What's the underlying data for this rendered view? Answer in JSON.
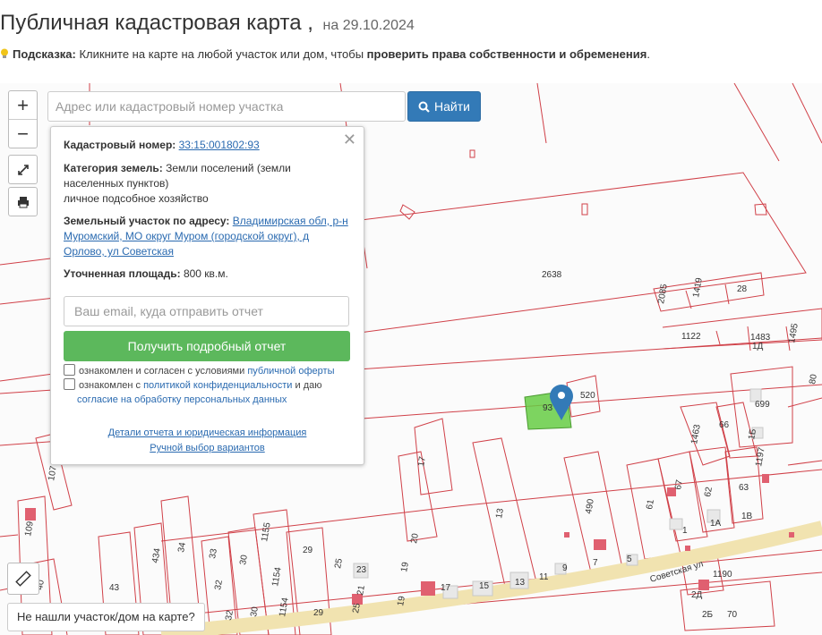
{
  "header": {
    "title": "Публичная кадастровая карта ,",
    "date": "на 29.10.2024",
    "hint_label": "Подсказка:",
    "hint_text": " Кликните на карте на любой участок или дом, чтобы ",
    "hint_bold": "проверить права собственности и обременения",
    "hint_end": "."
  },
  "search": {
    "placeholder": "Адрес или кадастровый номер участка",
    "button_label": "Найти"
  },
  "zoom": {
    "in": "+",
    "out": "−"
  },
  "popup": {
    "cadastral_label": "Кадастровый номер:",
    "cadastral_value": "33:15:001802:93",
    "category_label": "Категория земель:",
    "category_value": "Земли поселений (земли",
    "category_value_2": "населенных пунктов)",
    "use_value": "личное подсобное хозяйство",
    "address_label": "Земельный участок по адресу:",
    "address_value_1": "Владимирская обл, р-н",
    "address_value_2": "Муромский, МО округ Муром (городской округ), д",
    "address_value_3": "Орлово, ул Советская",
    "area_label": "Уточненная площадь:",
    "area_value": "800 кв.м.",
    "email_placeholder": "Ваш email, куда отправить отчет",
    "report_button": "Получить подробный отчет",
    "agree1_text": "ознакомлен и согласен с условиями ",
    "agree1_link": "публичной оферты",
    "agree2_text": "ознакомлен с ",
    "agree2_link": "политикой конфиденциальности",
    "agree2_text2": " и даю",
    "agree2_link2": "согласие на обработку персональных данных",
    "details_link": "Детали отчета и юридическая информация",
    "manual_link": "Ручной выбор вариантов"
  },
  "not_found": "Не нашли участок/дом на карте?",
  "map": {
    "street_label": "Советская ул",
    "parcel_labels": [
      "2638",
      "2085",
      "1419",
      "28",
      "1122",
      "1483",
      "1Д",
      "1495",
      "520",
      "93",
      "699",
      "66",
      "1463",
      "1Б",
      "80",
      "17",
      "13",
      "490",
      "67",
      "61",
      "62",
      "63",
      "1197",
      "1А",
      "1В",
      "1",
      "107",
      "109",
      "40",
      "43",
      "434",
      "34",
      "33",
      "32",
      "32",
      "30",
      "30",
      "1155",
      "1154",
      "1154",
      "29",
      "29",
      "25",
      "25",
      "23",
      "21",
      "19",
      "19",
      "20",
      "17",
      "15",
      "13",
      "11",
      "9",
      "7",
      "5",
      "1190",
      "2Д",
      "2Б",
      "70"
    ],
    "accent_color": "#337ab7",
    "selected_color": "#66cc44"
  }
}
